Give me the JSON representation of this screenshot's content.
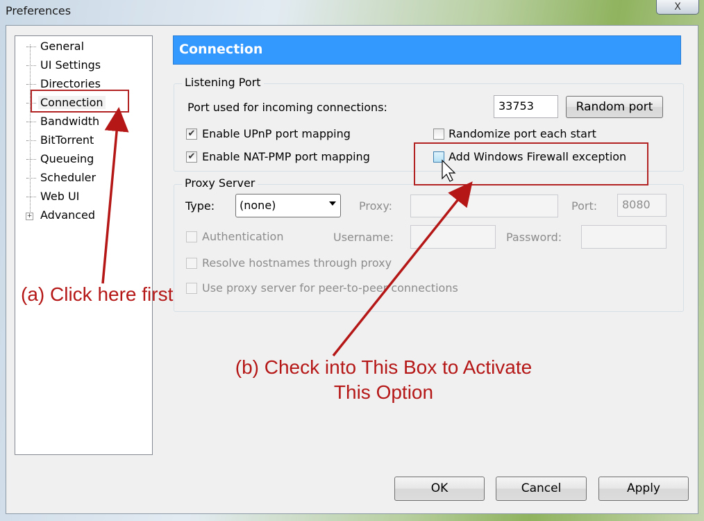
{
  "window": {
    "title": "Preferences",
    "close_glyph": "X"
  },
  "sidebar": {
    "items": [
      {
        "label": "General"
      },
      {
        "label": "UI Settings"
      },
      {
        "label": "Directories"
      },
      {
        "label": "Connection"
      },
      {
        "label": "Bandwidth"
      },
      {
        "label": "BitTorrent"
      },
      {
        "label": "Queueing"
      },
      {
        "label": "Scheduler"
      },
      {
        "label": "Web UI"
      },
      {
        "label": "Advanced"
      }
    ],
    "selected": "Connection"
  },
  "panel": {
    "title": "Connection"
  },
  "listening_port": {
    "title": "Listening Port",
    "port_label": "Port used for incoming connections:",
    "port_value": "33753",
    "random_port_button": "Random port",
    "upnp_label": "Enable UPnP port mapping",
    "upnp_checked": true,
    "natpmp_label": "Enable NAT-PMP port mapping",
    "natpmp_checked": true,
    "randomize_label": "Randomize port each start",
    "randomize_checked": false,
    "firewall_label": "Add Windows Firewall exception",
    "firewall_checked": false
  },
  "proxy_server": {
    "title": "Proxy Server",
    "type_label": "Type:",
    "type_value": "(none)",
    "proxy_label": "Proxy:",
    "proxy_value": "",
    "port_label": "Port:",
    "port_value": "8080",
    "auth_label": "Authentication",
    "username_label": "Username:",
    "username_value": "",
    "password_label": "Password:",
    "password_value": "",
    "resolve_label": "Resolve hostnames through proxy",
    "p2p_label": "Use proxy server for peer-to-peer connections"
  },
  "footer": {
    "ok": "OK",
    "cancel": "Cancel",
    "apply": "Apply"
  },
  "annotations": {
    "a": "(a) Click here first",
    "b_line1": "(b) Check into This Box to Activate",
    "b_line2": "This Option",
    "color": "#b51616"
  },
  "colors": {
    "header_bg": "#3399ff",
    "annotation": "#b51616"
  }
}
